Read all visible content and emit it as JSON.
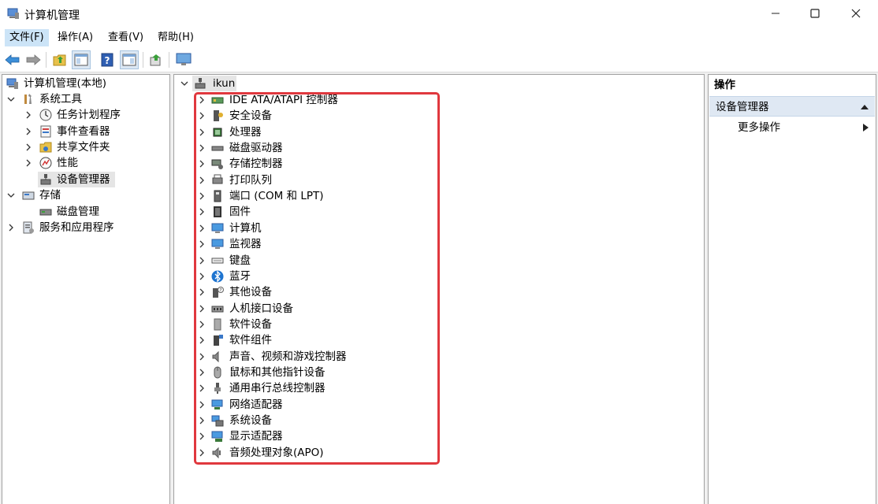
{
  "window": {
    "title": "计算机管理",
    "minimize_icon": "minimize-icon",
    "maximize_icon": "maximize-icon",
    "close_icon": "close-icon"
  },
  "menubar": {
    "items": [
      {
        "label": "文件(F)"
      },
      {
        "label": "操作(A)"
      },
      {
        "label": "查看(V)"
      },
      {
        "label": "帮助(H)"
      }
    ]
  },
  "toolbar": {
    "buttons": [
      "back-arrow-icon",
      "forward-arrow-icon",
      "up-folder-icon",
      "show-hide-tree-icon",
      "help-icon",
      "show-hide-action-pane-icon",
      "export-icon",
      "monitor-icon"
    ]
  },
  "left_tree": {
    "root": "计算机管理(本地)",
    "system_tools": "系统工具",
    "task_scheduler": "任务计划程序",
    "event_viewer": "事件查看器",
    "shared_folders": "共享文件夹",
    "performance": "性能",
    "device_manager": "设备管理器",
    "storage": "存储",
    "disk_management": "磁盘管理",
    "services_apps": "服务和应用程序"
  },
  "device_tree": {
    "root": "ikun",
    "categories": [
      {
        "label": "IDE ATA/ATAPI 控制器",
        "icon": "ide-controller-icon"
      },
      {
        "label": "安全设备",
        "icon": "security-device-icon"
      },
      {
        "label": "处理器",
        "icon": "processor-icon"
      },
      {
        "label": "磁盘驱动器",
        "icon": "disk-drive-icon"
      },
      {
        "label": "存储控制器",
        "icon": "storage-controller-icon"
      },
      {
        "label": "打印队列",
        "icon": "printer-icon"
      },
      {
        "label": "端口 (COM 和 LPT)",
        "icon": "port-icon"
      },
      {
        "label": "固件",
        "icon": "firmware-icon"
      },
      {
        "label": "计算机",
        "icon": "computer-icon"
      },
      {
        "label": "监视器",
        "icon": "monitor-icon"
      },
      {
        "label": "键盘",
        "icon": "keyboard-icon"
      },
      {
        "label": "蓝牙",
        "icon": "bluetooth-icon"
      },
      {
        "label": "其他设备",
        "icon": "other-device-icon"
      },
      {
        "label": "人机接口设备",
        "icon": "hid-icon"
      },
      {
        "label": "软件设备",
        "icon": "software-device-icon"
      },
      {
        "label": "软件组件",
        "icon": "software-component-icon"
      },
      {
        "label": "声音、视频和游戏控制器",
        "icon": "sound-icon"
      },
      {
        "label": "鼠标和其他指针设备",
        "icon": "mouse-icon"
      },
      {
        "label": "通用串行总线控制器",
        "icon": "usb-icon"
      },
      {
        "label": "网络适配器",
        "icon": "network-adapter-icon"
      },
      {
        "label": "系统设备",
        "icon": "system-device-icon"
      },
      {
        "label": "显示适配器",
        "icon": "display-adapter-icon"
      },
      {
        "label": "音频处理对象(APO)",
        "icon": "audio-apo-icon"
      }
    ]
  },
  "actions_pane": {
    "header": "操作",
    "section": "设备管理器",
    "more": "更多操作"
  },
  "colors": {
    "highlight_border": "#e0383e",
    "selection_bg": "#e5e5e5",
    "action_section_bg": "#dfe8f3",
    "accent_blue": "#1e74d0"
  }
}
